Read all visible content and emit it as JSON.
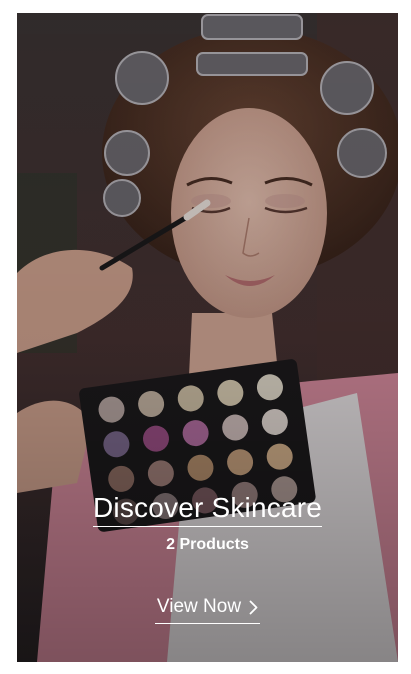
{
  "collection": {
    "title": "Discover Skincare",
    "product_count": "2 Products",
    "cta_label": "View Now",
    "cta_icon": "chevron-right-icon"
  },
  "colors": {
    "overlay": "#000000",
    "text": "#ffffff",
    "accent_pink": "#e9a7b5",
    "palette_case": "#1c1a1c"
  }
}
